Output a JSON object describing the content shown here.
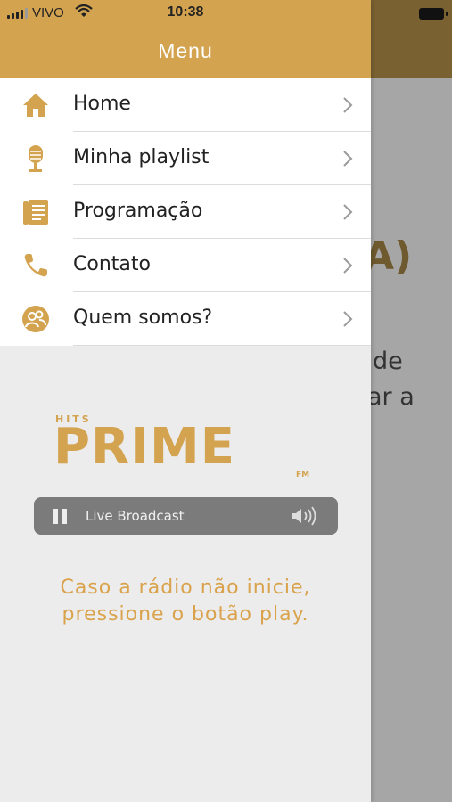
{
  "status_bar": {
    "carrier": "VIVO",
    "time": "10:38"
  },
  "background": {
    "heading_fragment": "A)",
    "line1": "de",
    "line2": "ar a"
  },
  "drawer": {
    "title": "Menu",
    "items": [
      {
        "label": "Home",
        "icon": "home-icon"
      },
      {
        "label": "Minha playlist",
        "icon": "microphone-icon"
      },
      {
        "label": "Programação",
        "icon": "schedule-icon"
      },
      {
        "label": "Contato",
        "icon": "phone-icon"
      },
      {
        "label": "Quem somos?",
        "icon": "people-icon"
      }
    ]
  },
  "logo": {
    "small": "HITS",
    "main": "PRIME",
    "suffix": "FM"
  },
  "player": {
    "label": "Live Broadcast",
    "state": "playing"
  },
  "message": {
    "line1": "Caso a rádio não inicie,",
    "line2": "pressione o botão play."
  },
  "colors": {
    "accent": "#d3a34f",
    "header_dark": "#7a6131",
    "drawer_bg": "#ececec",
    "player_bg": "#7b7b7b"
  }
}
